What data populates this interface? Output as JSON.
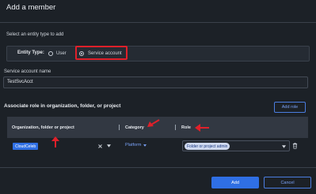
{
  "dialog": {
    "title": "Add a member"
  },
  "entity": {
    "section_label": "Select an entity type to add",
    "type_label": "Entity Type:",
    "options": [
      {
        "label": "User",
        "selected": false
      },
      {
        "label": "Service account",
        "selected": true
      }
    ]
  },
  "account": {
    "label": "Service account name",
    "value": "TestSvcAcct"
  },
  "roles": {
    "heading": "Associate role in organization, folder, or project",
    "add_role_label": "Add role",
    "columns": [
      "Organization, folder or project",
      "Category",
      "Role"
    ],
    "rows": [
      {
        "org": "CloudCeleb",
        "category": "Platform",
        "role": "Folder or project admin"
      }
    ]
  },
  "footer": {
    "add_label": "Add",
    "cancel_label": "Cancel"
  },
  "icons": {
    "clear": "close-icon",
    "dropdown": "chevron-down-icon",
    "delete": "trash-icon",
    "annotation": "red-arrow-icon"
  },
  "colors": {
    "accent": "#2f6fe4",
    "annotation": "#e0202a",
    "background": "#1c2127"
  }
}
